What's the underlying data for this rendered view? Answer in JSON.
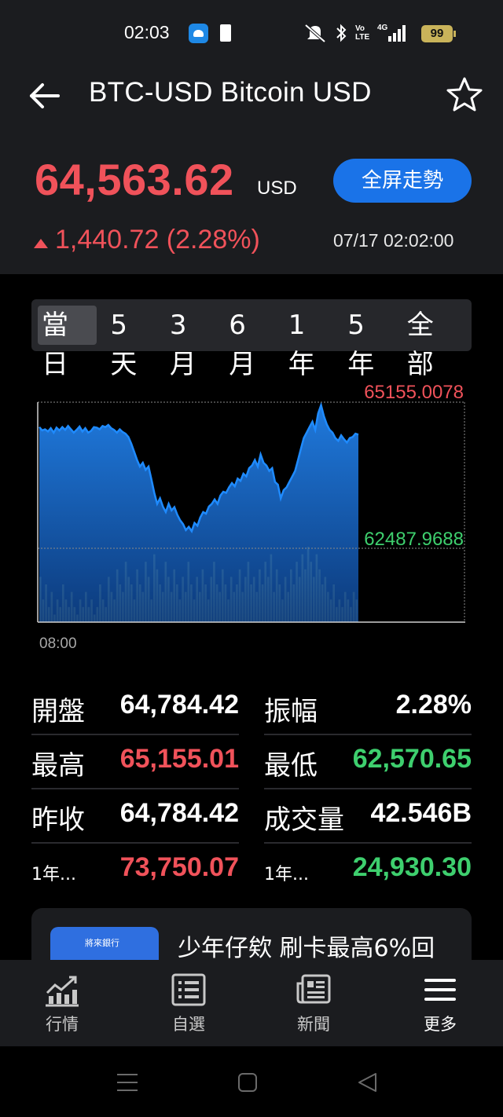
{
  "status_bar": {
    "time": "02:03",
    "network": "4G",
    "volte": "Vo LTE",
    "battery": "99"
  },
  "header": {
    "title": "BTC-USD Bitcoin USD",
    "price": "64,563.62",
    "unit": "USD",
    "fullscreen_label": "全屏走勢",
    "change": "1,440.72 (2.28%)",
    "datetime": "07/17 02:02:00"
  },
  "period_tabs": [
    "當日",
    "5天",
    "3月",
    "6月",
    "1年",
    "5年",
    "全部"
  ],
  "active_tab": "當日",
  "chart_data": {
    "type": "area",
    "high_label": "65155.0078",
    "low_label": "62487.9688",
    "x_tick": "08:00",
    "ylim": [
      62487.9688,
      65155.0078
    ],
    "price_values": [
      64700,
      64640,
      64660,
      64620,
      64680,
      64600,
      64690,
      64640,
      64700,
      64650,
      64720,
      64660,
      64600,
      64650,
      64710,
      64620,
      64680,
      64600,
      64630,
      64700,
      64690,
      64660,
      64720,
      64700,
      64740,
      64680,
      64650,
      64600,
      64660,
      64610,
      64580,
      64520,
      64400,
      64250,
      64100,
      63980,
      64050,
      63920,
      63980,
      63750,
      63500,
      63300,
      63400,
      63250,
      63150,
      63300,
      63180,
      63240,
      63100,
      63000,
      62930,
      62820,
      62880,
      62800,
      62950,
      62900,
      63050,
      63150,
      63120,
      63250,
      63300,
      63380,
      63300,
      63450,
      63520,
      63500,
      63600,
      63680,
      63620,
      63760,
      63720,
      63850,
      63800,
      63950,
      64000,
      64100,
      63980,
      64200,
      64050,
      64000,
      63900,
      63950,
      63700,
      63650,
      63400,
      63550,
      63600,
      63700,
      63800,
      63900,
      64100,
      64300,
      64500,
      64600,
      64700,
      64800,
      64650,
      64950,
      65100,
      64900,
      64750,
      64650,
      64600,
      64500,
      64450,
      64550,
      64480,
      64420,
      64500,
      64520,
      64580,
      64563
    ],
    "volume_values": [
      0.6,
      0.3,
      0.5,
      0.2,
      0.4,
      0.1,
      0.3,
      0.2,
      0.5,
      0.3,
      0.2,
      0.4,
      0.2,
      0.1,
      0.3,
      0.2,
      0.4,
      0.2,
      0.3,
      0.1,
      0.2,
      0.5,
      0.3,
      0.2,
      0.6,
      0.4,
      0.3,
      0.7,
      0.5,
      0.4,
      0.8,
      0.6,
      0.5,
      0.3,
      0.7,
      0.5,
      0.4,
      0.8,
      0.6,
      0.3,
      0.9,
      0.7,
      0.5,
      0.4,
      0.8,
      0.6,
      0.4,
      0.7,
      0.5,
      0.3,
      0.6,
      0.4,
      0.8,
      0.5,
      0.3,
      0.6,
      0.4,
      0.7,
      0.5,
      0.3,
      0.6,
      0.8,
      0.5,
      0.4,
      0.7,
      0.5,
      0.3,
      0.6,
      0.4,
      0.5,
      0.7,
      0.4,
      0.6,
      0.8,
      0.5,
      0.6,
      0.4,
      0.7,
      0.5,
      0.8,
      0.6,
      0.9,
      0.4,
      0.7,
      0.5,
      0.3,
      0.6,
      0.4,
      0.7,
      0.5,
      0.8,
      0.6,
      0.9,
      0.7,
      1.0,
      0.8,
      0.6,
      0.9,
      0.7,
      0.5,
      0.6,
      0.4,
      0.3,
      0.5,
      0.2,
      0.3,
      0.2,
      0.4,
      0.3,
      0.2,
      0.4,
      0.3
    ]
  },
  "stats": {
    "open": {
      "label": "開盤",
      "value": "64,784.42"
    },
    "amplitude": {
      "label": "振幅",
      "value": "2.28%"
    },
    "high": {
      "label": "最高",
      "value": "65,155.01"
    },
    "low": {
      "label": "最低",
      "value": "62,570.65"
    },
    "prev_close": {
      "label": "昨收",
      "value": "64,784.42"
    },
    "volume": {
      "label": "成交量",
      "value": "42.546B"
    },
    "year_high": {
      "label": "1年...",
      "value": "73,750.07"
    },
    "year_low": {
      "label": "1年...",
      "value": "24,930.30"
    }
  },
  "ad": {
    "text": "少年仔欸 刷卡最高6%回",
    "image_text": "將來銀行"
  },
  "bottom_nav": [
    {
      "label": "行情",
      "icon": "chart-icon"
    },
    {
      "label": "自選",
      "icon": "list-icon"
    },
    {
      "label": "新聞",
      "icon": "news-icon"
    },
    {
      "label": "更多",
      "icon": "menu-icon"
    }
  ],
  "colors": {
    "up": "#f0525a",
    "down": "#3ecf6e",
    "accent": "#1a73e8",
    "area": "#1f78e0",
    "volume": "#e6e24a"
  }
}
